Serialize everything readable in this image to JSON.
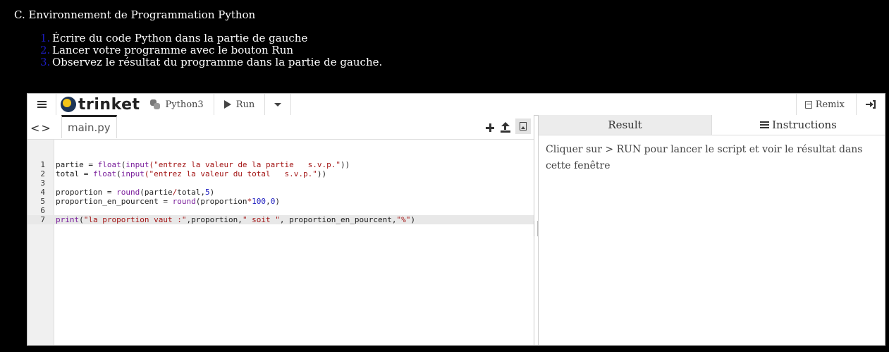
{
  "page": {
    "heading": "C. Environnement de Programmation Python",
    "steps": [
      {
        "num": "1.",
        "text": "Écrire du code Python dans la partie de gauche"
      },
      {
        "num": "2.",
        "text": "Lancer votre programme avec le bouton Run"
      },
      {
        "num": "3.",
        "text": "Observez le résultat du programme dans la partie de gauche."
      }
    ]
  },
  "toolbar": {
    "logo_text": "trinket",
    "language": "Python3",
    "run_label": "Run",
    "remix_label": "Remix"
  },
  "editor": {
    "nav_arrows": "<>",
    "file_tab": "main.py",
    "lines": [
      {
        "n": "1",
        "tokens": [
          [
            "partie = ",
            ""
          ],
          [
            "float",
            "kw"
          ],
          [
            "(",
            ""
          ],
          [
            "input",
            "kw"
          ],
          [
            "(\"entrez la valeur de la partie   s.v.p.\"",
            "str"
          ],
          [
            "))",
            ""
          ]
        ]
      },
      {
        "n": "2",
        "tokens": [
          [
            "total = ",
            ""
          ],
          [
            "float",
            "kw"
          ],
          [
            "(",
            ""
          ],
          [
            "input",
            "kw"
          ],
          [
            "(\"entrez la valeur du total   s.v.p.\"",
            "str"
          ],
          [
            "))",
            ""
          ]
        ]
      },
      {
        "n": "3",
        "tokens": []
      },
      {
        "n": "4",
        "tokens": [
          [
            "proportion = ",
            ""
          ],
          [
            "round",
            "kw"
          ],
          [
            "(partie",
            ""
          ],
          [
            "/",
            "op"
          ],
          [
            "total,",
            ""
          ],
          [
            "5",
            "num"
          ],
          [
            ")",
            ""
          ]
        ]
      },
      {
        "n": "5",
        "tokens": [
          [
            "proportion_en_pourcent = ",
            ""
          ],
          [
            "round",
            "kw"
          ],
          [
            "(proportion",
            ""
          ],
          [
            "*",
            "op"
          ],
          [
            "100",
            "num"
          ],
          [
            ",",
            ""
          ],
          [
            "0",
            "num"
          ],
          [
            ")",
            ""
          ]
        ]
      },
      {
        "n": "6",
        "tokens": []
      },
      {
        "n": "7",
        "active": true,
        "tokens": [
          [
            "print",
            "kw"
          ],
          [
            "(",
            ""
          ],
          [
            "\"la proportion vaut :\"",
            "str"
          ],
          [
            ",proportion,",
            ""
          ],
          [
            "\" soit \"",
            "str"
          ],
          [
            ", proportion_en_pourcent,",
            ""
          ],
          [
            "\"%\"",
            "str"
          ],
          [
            ")",
            ""
          ]
        ]
      }
    ]
  },
  "output": {
    "tabs": {
      "result": "Result",
      "instructions": "Instructions"
    },
    "instructions_text": "Cliquer sur > RUN pour lancer le script et voir le résultat dans cette fenêtre"
  }
}
